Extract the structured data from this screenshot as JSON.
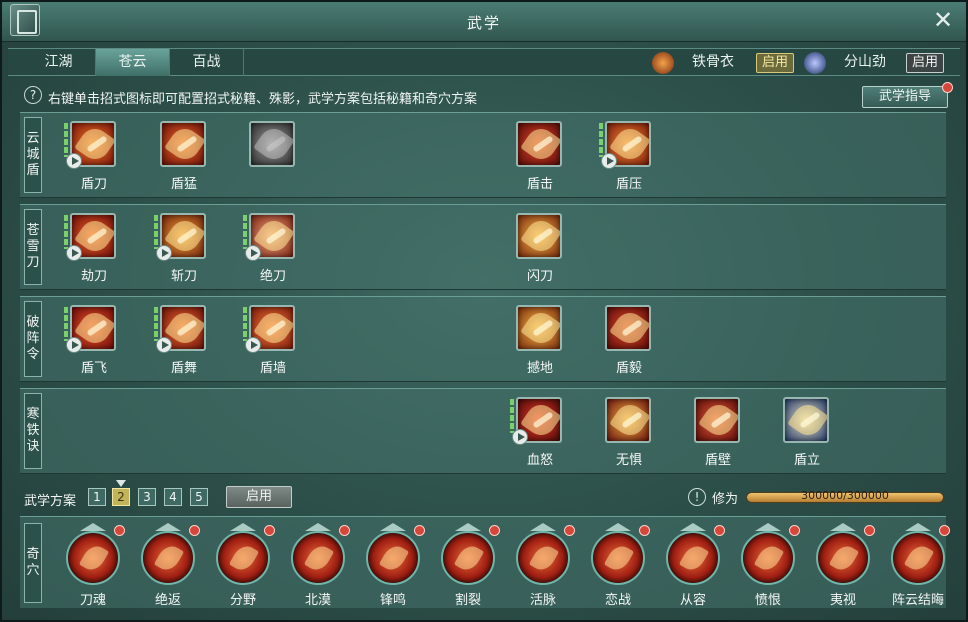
{
  "window": {
    "title": "武学"
  },
  "tabs": [
    {
      "label": "江湖"
    },
    {
      "label": "苍云"
    },
    {
      "label": "百战"
    }
  ],
  "equips": [
    {
      "name": "铁骨衣",
      "button": "启用"
    },
    {
      "name": "分山劲",
      "button": "启用"
    }
  ],
  "hint": {
    "icon": "?",
    "text": "右键单击招式图标即可配置招式秘籍、殊影，武学方案包括秘籍和奇穴方案"
  },
  "guide_button": "武学指导",
  "rows": [
    {
      "label": "云城盾",
      "skills": [
        {
          "name": "盾刀"
        },
        {
          "name": "盾猛"
        },
        {
          "name": ""
        },
        {
          "name": "盾击"
        },
        {
          "name": "盾压"
        }
      ]
    },
    {
      "label": "苍雪刀",
      "skills": [
        {
          "name": "劫刀"
        },
        {
          "name": "斩刀"
        },
        {
          "name": "绝刀"
        },
        {
          "name": "闪刀"
        }
      ]
    },
    {
      "label": "破阵令",
      "skills": [
        {
          "name": "盾飞"
        },
        {
          "name": "盾舞"
        },
        {
          "name": "盾墙"
        },
        {
          "name": "撼地"
        },
        {
          "name": "盾毅"
        }
      ]
    },
    {
      "label": "寒铁诀",
      "skills": [
        {
          "name": "血怒"
        },
        {
          "name": "无惧"
        },
        {
          "name": "盾壁"
        },
        {
          "name": "盾立"
        }
      ]
    }
  ],
  "scheme": {
    "label": "武学方案",
    "numbers": [
      "1",
      "2",
      "3",
      "4",
      "5"
    ],
    "selected": "2",
    "apply": "启用"
  },
  "xiuwei": {
    "icon": "!",
    "label": "修为",
    "value": "300000/300000",
    "fraction": 1.0
  },
  "qixue": {
    "label": "奇穴",
    "items": [
      {
        "name": "刀魂"
      },
      {
        "name": "绝返"
      },
      {
        "name": "分野"
      },
      {
        "name": "北漠"
      },
      {
        "name": "锋鸣"
      },
      {
        "name": "割裂"
      },
      {
        "name": "活脉"
      },
      {
        "name": "恋战"
      },
      {
        "name": "从容"
      },
      {
        "name": "愤恨"
      },
      {
        "name": "夷视"
      },
      {
        "name": "阵云结晦"
      }
    ]
  },
  "colors": {
    "panel": "#2e524c",
    "accent_gold": "#c2b458",
    "alert_red": "#d6463b",
    "xp_fill": "#f0c46f"
  }
}
